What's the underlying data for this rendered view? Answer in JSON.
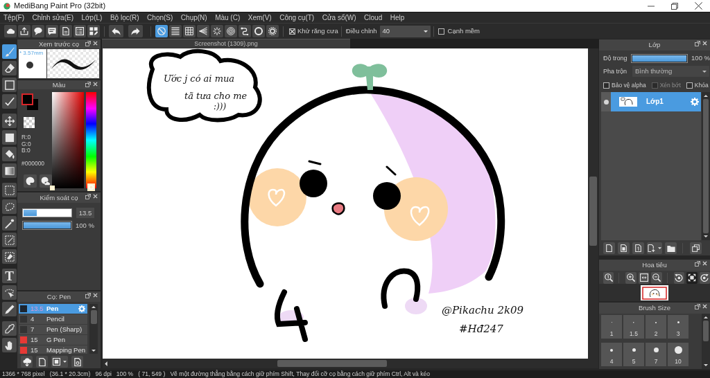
{
  "window": {
    "title": "MediBang Paint Pro (32bit)"
  },
  "menu": [
    "Tệp(F)",
    "Chỉnh sửa(E)",
    "Lớp(L)",
    "Bộ lọc(R)",
    "Chọn(S)",
    "Chụp(N)",
    "Màu (C)",
    "Xem(V)",
    "Công cụ(T)",
    "Cửa sổ(W)",
    "Cloud",
    "Help"
  ],
  "toolbar": {
    "rulers": [
      {
        "selected": true
      },
      {
        "selected": false
      },
      {
        "selected": false
      },
      {
        "selected": false
      },
      {
        "selected": false
      },
      {
        "selected": false
      },
      {
        "selected": false
      },
      {
        "selected": false
      },
      {
        "selected": false
      }
    ],
    "antialias": {
      "label": "Khử răng cưa",
      "checked": true
    },
    "correction": {
      "label": "Điều chỉnh",
      "value": "40"
    },
    "soft_edge": {
      "label": "Cạnh mềm",
      "checked": false
    }
  },
  "tools": [
    {
      "selected": true
    },
    {
      "selected": false
    },
    {
      "selected": false
    },
    {
      "selected": false
    },
    {
      "selected": false
    },
    {
      "selected": false
    },
    {
      "selected": false
    },
    {
      "selected": false
    },
    {
      "selected": false
    },
    {
      "selected": false
    },
    {
      "selected": false
    },
    {
      "selected": false
    },
    {
      "selected": false
    },
    {
      "selected": false,
      "glyph": "T"
    },
    {
      "selected": false
    },
    {
      "selected": false
    },
    {
      "selected": false
    },
    {
      "selected": false
    }
  ],
  "brush_preview": {
    "title": "Xem trước cọ",
    "size": "* 3.57mm"
  },
  "color_panel": {
    "title": "Màu",
    "channels": [
      "R:0",
      "G:0",
      "B:0"
    ],
    "hex": "#000000",
    "hue": {
      "level": 0
    }
  },
  "brush_control": {
    "title": "Kiểm soát cọ",
    "sliders": [
      {
        "kind": "size",
        "level": 0.28,
        "reading": "13.5"
      },
      {
        "kind": "opacity",
        "level": 1,
        "reading": "100 %"
      }
    ]
  },
  "brush_list": {
    "title": "Cọ: Pen",
    "items": [
      {
        "color": "#1c2530",
        "size": "13.5",
        "name": "Pen",
        "selected": true
      },
      {
        "color": "#333333",
        "size": "4",
        "name": "Pencil",
        "selected": false
      },
      {
        "color": "#333333",
        "size": "7",
        "name": "Pen (Sharp)",
        "selected": false
      },
      {
        "color": "#e53935",
        "size": "15",
        "name": "G Pen",
        "selected": false
      },
      {
        "color": "#e53935",
        "size": "15",
        "name": "Mapping Pen",
        "selected": false
      }
    ]
  },
  "document": {
    "tab": "Screenshot (1309).png",
    "bubble_lines": [
      "Ước j có ai mua",
      "tã tưa cho me",
      ":)))"
    ],
    "signature_lines": [
      "@Pikachu 2k09",
      "#Hđ247"
    ]
  },
  "layer_panel": {
    "title": "Lớp",
    "opacity": {
      "label": "Độ trong",
      "level": 1,
      "reading": "100 %"
    },
    "blend": {
      "label": "Pha trộn",
      "value": "Bình thường"
    },
    "options": [
      {
        "label": "Bảo vệ alpha",
        "checked": false,
        "disabled": false
      },
      {
        "label": "Xén bớt",
        "checked": false,
        "disabled": true
      },
      {
        "label": "Khóa",
        "checked": false,
        "disabled": false
      }
    ],
    "layers": [
      {
        "name": "Lớp1",
        "selected": true,
        "visible": true
      }
    ]
  },
  "navigator": {
    "title": "Hoa tiêu"
  },
  "brush_size": {
    "title": "Brush Size",
    "items": [
      "1",
      "1.5",
      "2",
      "3",
      "4",
      "5",
      "7",
      "10"
    ]
  },
  "status_bar": {
    "image_size": "1366 * 768 pixel",
    "print_size": "(36.1 * 20.3cm)",
    "resolution": "96 dpi",
    "zoom": "100 %",
    "cursor": "( 71, 549 )",
    "hint": "Vẽ một đường thẳng bằng cách giữ phím Shift, Thay đổi cỡ cọ bằng cách giữ phím Ctrl, Alt và kéo"
  }
}
